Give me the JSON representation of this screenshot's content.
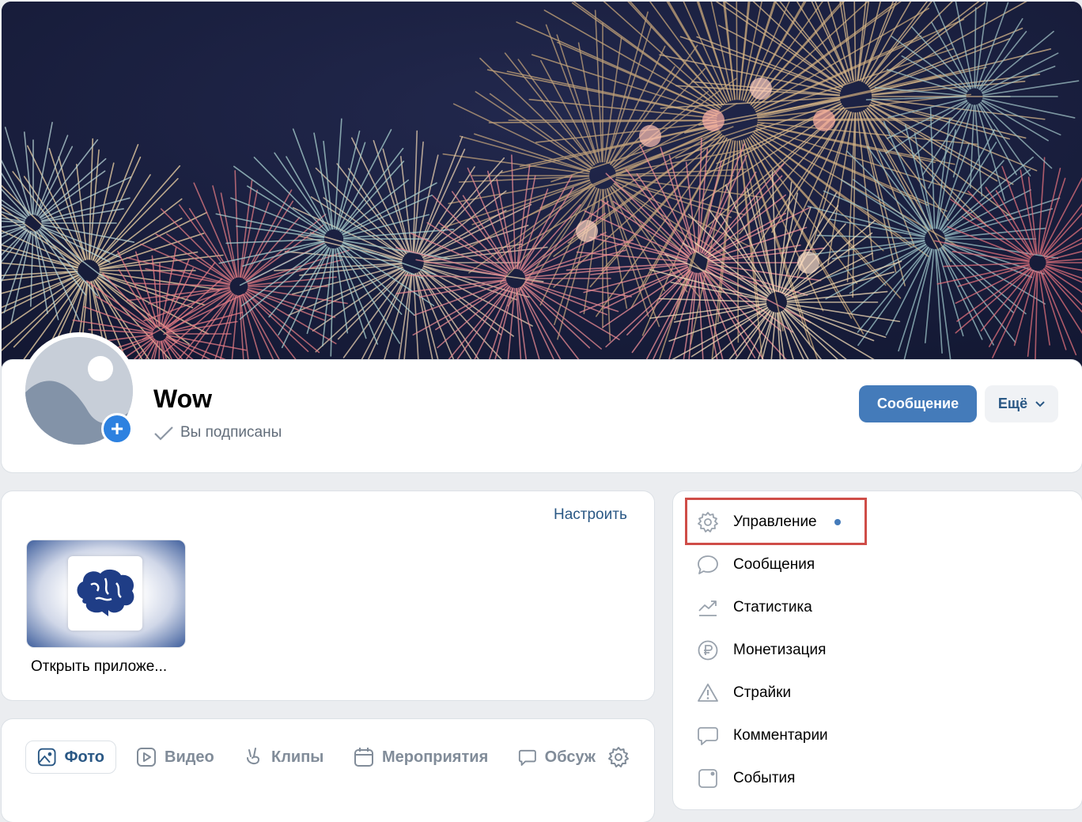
{
  "group": {
    "name": "Wow",
    "subscribed_label": "Вы подписаны"
  },
  "actions": {
    "message_label": "Сообщение",
    "more_label": "Ещё"
  },
  "apps": {
    "customize_label": "Настроить",
    "app_label": "Открыть приложе..."
  },
  "tabs": [
    {
      "label": "Фото",
      "icon": "photo-icon",
      "active": true
    },
    {
      "label": "Видео",
      "icon": "video-icon",
      "active": false
    },
    {
      "label": "Клипы",
      "icon": "clips-icon",
      "active": false
    },
    {
      "label": "Мероприятия",
      "icon": "calendar-icon",
      "active": false
    },
    {
      "label": "Обсуж",
      "icon": "discussion-icon",
      "active": false
    }
  ],
  "menu": {
    "items": [
      {
        "label": "Управление",
        "icon": "gear-icon",
        "has_dot": true
      },
      {
        "label": "Сообщения",
        "icon": "message-bubble-icon"
      },
      {
        "label": "Статистика",
        "icon": "chart-trend-icon"
      },
      {
        "label": "Монетизация",
        "icon": "ruble-icon"
      },
      {
        "label": "Страйки",
        "icon": "warning-icon"
      },
      {
        "label": "Комментарии",
        "icon": "comment-icon"
      },
      {
        "label": "События",
        "icon": "events-icon"
      }
    ]
  },
  "colors": {
    "accent": "#447bba",
    "link": "#2a5885",
    "highlight": "#cf4d48"
  }
}
